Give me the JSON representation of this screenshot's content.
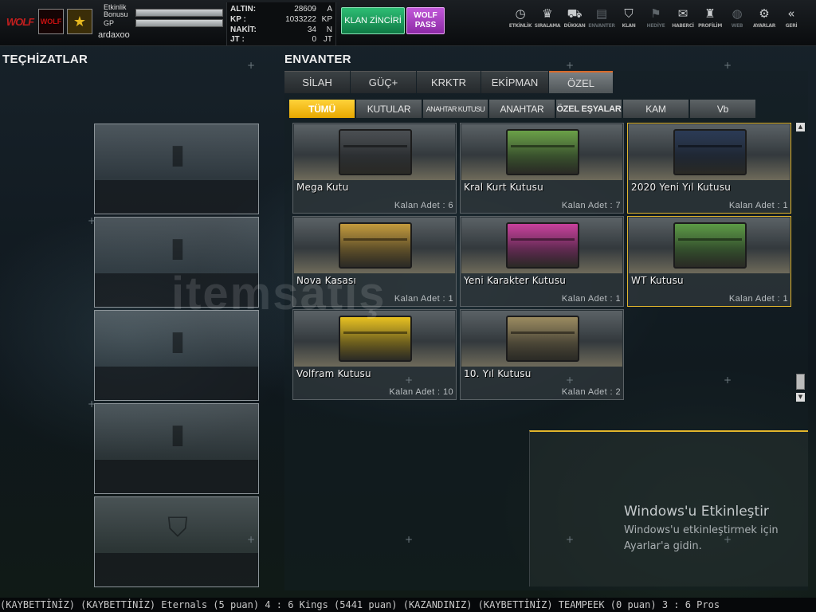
{
  "topbar": {
    "logo_text": "WOLF",
    "clan_text": "WOLF",
    "rank_symbol": "★",
    "player": {
      "event_bonus_label": "Etkinlik Bonusu",
      "gp_label": "GP",
      "name": "ardaxoo"
    },
    "currency": [
      {
        "label": "ALTIN:",
        "value": "28609",
        "unit": "A"
      },
      {
        "label": "KP   :",
        "value": "1033222",
        "unit": "KP"
      },
      {
        "label": "NAKİT:",
        "value": "34",
        "unit": "N"
      },
      {
        "label": "JT   :",
        "value": "0",
        "unit": "JT"
      }
    ],
    "klan_button": "KLAN ZİNCİRİ",
    "wolf_pass_button": "WOLF PASS",
    "nav": [
      {
        "icon": "clock-icon",
        "glyph": "◷",
        "label": "ETKİNLİK",
        "enabled": true
      },
      {
        "icon": "medal-icon",
        "glyph": "♛",
        "label": "SIRALAMA",
        "enabled": true
      },
      {
        "icon": "cart-icon",
        "glyph": "⛟",
        "label": "DÜKKAN",
        "enabled": true
      },
      {
        "icon": "film-icon",
        "glyph": "▤",
        "label": "ENVANTER",
        "enabled": false
      },
      {
        "icon": "shield-icon",
        "glyph": "⛉",
        "label": "KLAN",
        "enabled": true
      },
      {
        "icon": "gift-icon",
        "glyph": "⚑",
        "label": "HEDİYE",
        "enabled": false
      },
      {
        "icon": "megaphone-icon",
        "glyph": "✉",
        "label": "HABERCİ",
        "enabled": true
      },
      {
        "icon": "user-icon",
        "glyph": "♜",
        "label": "PROFİLİM",
        "enabled": true
      },
      {
        "icon": "globe-icon",
        "glyph": "◍",
        "label": "WEB",
        "enabled": false
      },
      {
        "icon": "gear-icon",
        "glyph": "⚙",
        "label": "AYARLAR",
        "enabled": true
      },
      {
        "icon": "back-icon",
        "glyph": "«",
        "label": "GERİ",
        "enabled": true
      }
    ]
  },
  "left": {
    "title": "TEÇHİZATLAR",
    "slot_icons": [
      {
        "icon": "spray-icon",
        "glyph": "▮"
      },
      {
        "icon": "spray-icon",
        "glyph": "▮"
      },
      {
        "icon": "spray-icon",
        "glyph": "▮"
      },
      {
        "icon": "spray-icon",
        "glyph": "▮"
      },
      {
        "icon": "shield-icon",
        "glyph": "⛉"
      }
    ]
  },
  "inventory": {
    "title": "ENVANTER",
    "tabs": [
      "SİLAH",
      "GÜÇ+",
      "KRKTR",
      "EKİPMAN",
      "ÖZEL"
    ],
    "active_tab": "ÖZEL",
    "subtabs": [
      "TÜMÜ",
      "KUTULAR",
      "ANAHTAR KUTUSU",
      "ANAHTAR",
      "ÖZEL EŞYALAR",
      "KAM",
      "Vb"
    ],
    "active_subtab": "TÜMÜ",
    "items": [
      {
        "name": "Mega Kutu",
        "qty": "Kalan Adet : 6",
        "color": "#4a4e52",
        "selected": false
      },
      {
        "name": "Kral Kurt Kutusu",
        "qty": "Kalan Adet : 7",
        "color": "#6aa047",
        "selected": false
      },
      {
        "name": "2020 Yeni Yıl Kutusu",
        "qty": "Kalan Adet : 1",
        "color": "#2a3a55",
        "selected": true
      },
      {
        "name": "Nova Kasası",
        "qty": "Kalan Adet : 1",
        "color": "#c39a3c",
        "selected": false
      },
      {
        "name": "Yeni Karakter Kutusu",
        "qty": "Kalan Adet : 1",
        "color": "#c8409c",
        "selected": false
      },
      {
        "name": "WT Kutusu",
        "qty": "Kalan Adet : 1",
        "color": "#5c9a45",
        "selected": true
      },
      {
        "name": "Volfram Kutusu",
        "qty": "Kalan Adet : 10",
        "color": "#e8c120",
        "selected": false
      },
      {
        "name": "10. Yıl Kutusu",
        "qty": "Kalan Adet : 2",
        "color": "#9a8a60",
        "selected": false
      }
    ]
  },
  "overlay": {
    "watermark": "itemsatış",
    "windows_title": "Windows'u Etkinleştir",
    "windows_line1": "Windows'u etkinleştirmek için",
    "windows_line2": "Ayarlar'a gidin."
  },
  "ticker": " (KAYBETTİNİZ)    (KAYBETTİNİZ) Eternals (5 puan) 4 : 6 Kings (5441 puan) (KAZANDINIZ)      (KAYBETTİNİZ) TEAMPEEK (0 puan) 3 : 6 Pros"
}
